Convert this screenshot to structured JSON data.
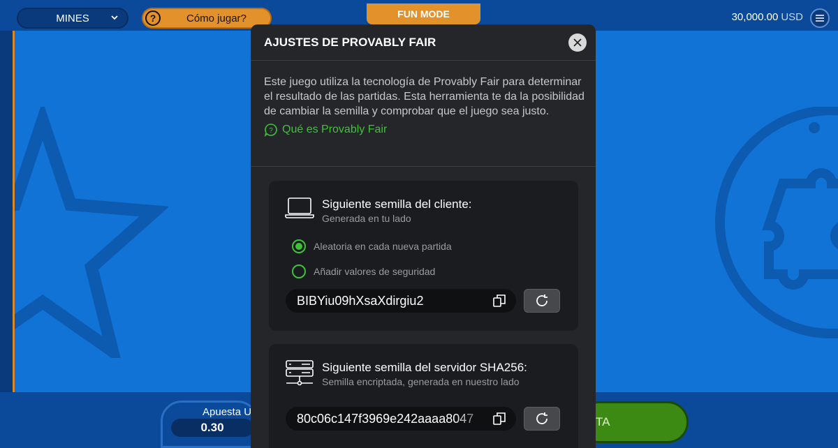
{
  "topbar": {
    "game_select": "MINES",
    "how_to_play": "Cómo jugar?",
    "fun_mode": "FUN MODE",
    "balance_amount": "30,000.00",
    "balance_currency": "USD"
  },
  "bottombar": {
    "bet_label": "Apuesta U",
    "bet_value": "0.30",
    "play_label": "TA"
  },
  "modal": {
    "title": "AJUSTES DE PROVABLY FAIR",
    "intro": "Este juego utiliza la tecnología de Provably Fair para determinar el resultado de las partidas. Esta herramienta te da la posibilidad de cambiar la semilla y comprobar que el juego sea justo.",
    "link_label": "Qué es Provably Fair",
    "client_seed": {
      "title": "Siguiente semilla del cliente:",
      "subtitle": "Generada en tu lado",
      "options": [
        {
          "label": "Aleatoria en cada nueva partida",
          "selected": true
        },
        {
          "label": "Añadir valores de seguridad",
          "selected": false
        }
      ],
      "value": "BIBYiu09hXsaXdirgiu2"
    },
    "server_seed": {
      "title": "Siguiente semilla del servidor SHA256:",
      "subtitle": "Semilla encriptada, generada en nuestro lado",
      "value": "80c06c147f3969e242aaaa8047"
    }
  },
  "colors": {
    "accent_green": "#3fc13a",
    "orange": "#e3922b",
    "modal_bg": "#242629",
    "game_blue": "#1273d6"
  }
}
